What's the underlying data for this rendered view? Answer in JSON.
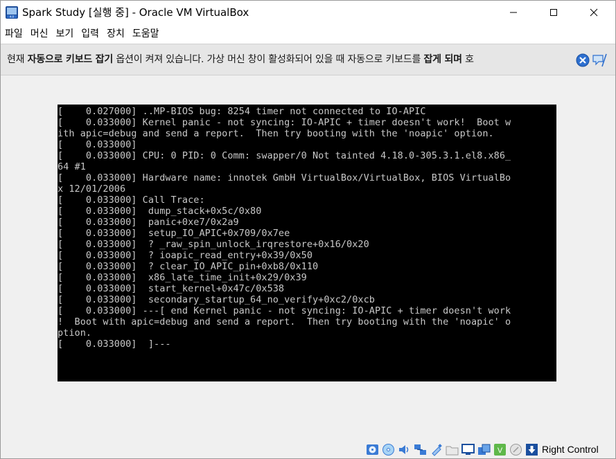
{
  "window": {
    "title": "Spark Study [실행 중] - Oracle VM VirtualBox"
  },
  "menu": {
    "items": [
      "파일",
      "머신",
      "보기",
      "입력",
      "장치",
      "도움말"
    ]
  },
  "notice": {
    "segments": [
      {
        "text": "현재 ",
        "bold": false
      },
      {
        "text": "자동으로 키보드 잡기",
        "bold": true
      },
      {
        "text": " 옵션이 켜져 있습니다. 가상 머신 창이 활성화되어 있을 때 자동으로 키보드를 ",
        "bold": false
      },
      {
        "text": "잡게 되며",
        "bold": true
      },
      {
        "text": " 호",
        "bold": false
      }
    ]
  },
  "console": {
    "lines": [
      "[    0.027000] ..MP-BIOS bug: 8254 timer not connected to IO-APIC",
      "[    0.033000] Kernel panic - not syncing: IO-APIC + timer doesn't work!  Boot w",
      "ith apic=debug and send a report.  Then try booting with the 'noapic' option.",
      "[    0.033000]",
      "[    0.033000] CPU: 0 PID: 0 Comm: swapper/0 Not tainted 4.18.0-305.3.1.el8.x86_",
      "64 #1",
      "[    0.033000] Hardware name: innotek GmbH VirtualBox/VirtualBox, BIOS VirtualBo",
      "x 12/01/2006",
      "[    0.033000] Call Trace:",
      "[    0.033000]  dump_stack+0x5c/0x80",
      "[    0.033000]  panic+0xe7/0x2a9",
      "[    0.033000]  setup_IO_APIC+0x709/0x7ee",
      "[    0.033000]  ? _raw_spin_unlock_irqrestore+0x16/0x20",
      "[    0.033000]  ? ioapic_read_entry+0x39/0x50",
      "[    0.033000]  ? clear_IO_APIC_pin+0xb8/0x110",
      "[    0.033000]  x86_late_time_init+0x29/0x39",
      "[    0.033000]  start_kernel+0x47c/0x538",
      "[    0.033000]  secondary_startup_64_no_verify+0xc2/0xcb",
      "[    0.033000] ---[ end Kernel panic - not syncing: IO-APIC + timer doesn't work",
      "!  Boot with apic=debug and send a report.  Then try booting with the 'noapic' o",
      "ption.",
      "[    0.033000]  ]---"
    ]
  },
  "statusbar": {
    "host_key_label": "Right Control",
    "icons": [
      "hard-disk-icon",
      "optical-drive-icon",
      "audio-icon",
      "network-icon",
      "usb-icon",
      "shared-folders-icon",
      "display-icon",
      "recording-icon",
      "guest-additions-icon",
      "mouse-integration-icon",
      "keyboard-capture-icon"
    ]
  },
  "colors": {
    "console_fg": "#c8c8c8",
    "console_bg": "#000000",
    "notice_bg": "#e6e6e6"
  }
}
